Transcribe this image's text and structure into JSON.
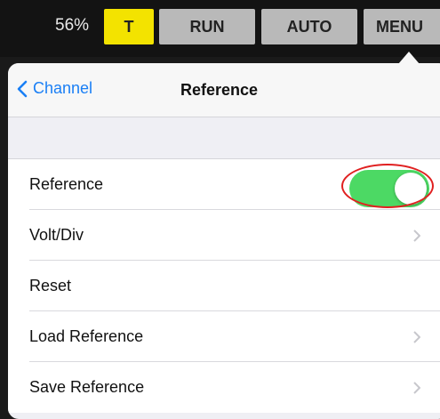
{
  "topbar": {
    "battery": "56%",
    "t_label": "T",
    "run_label": "RUN",
    "auto_label": "AUTO",
    "menu_label": "MENU"
  },
  "nav": {
    "back_label": "Channel",
    "title": "Reference"
  },
  "rows": [
    {
      "label": "Reference",
      "type": "toggle",
      "on": true
    },
    {
      "label": "Volt/Div",
      "type": "disclosure"
    },
    {
      "label": "Reset",
      "type": "action"
    },
    {
      "label": "Load Reference",
      "type": "disclosure"
    },
    {
      "label": "Save Reference",
      "type": "disclosure"
    }
  ],
  "colors": {
    "accent": "#1a7ff5",
    "toggle_on": "#4cd964",
    "t_button": "#f3e300",
    "highlight_circle": "#e02020"
  },
  "icons": [
    "chevron-left-icon",
    "chevron-right-icon"
  ]
}
